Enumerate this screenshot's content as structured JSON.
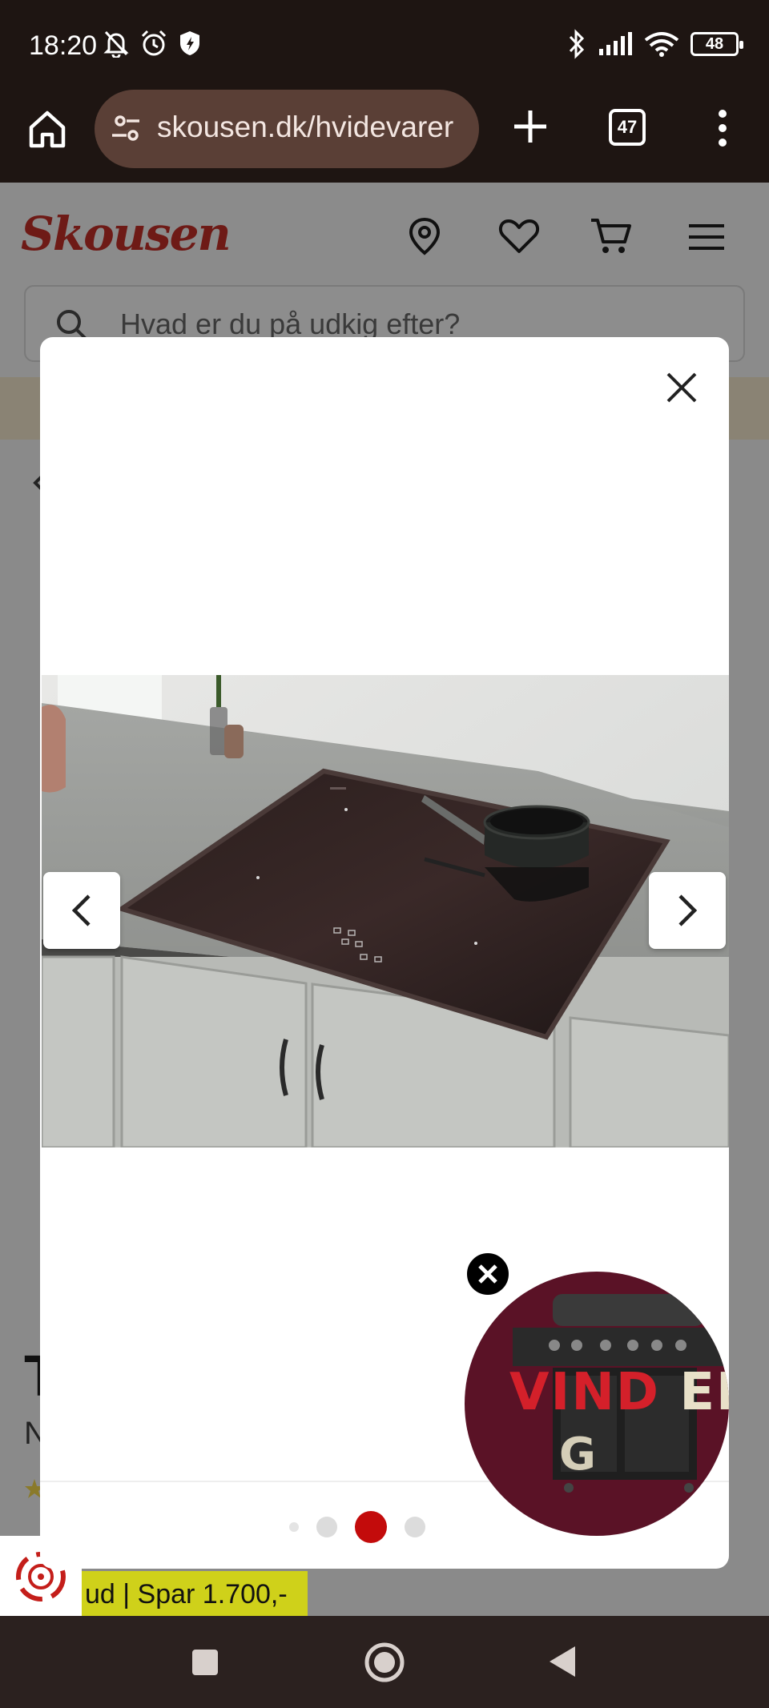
{
  "status_bar": {
    "time": "18:20",
    "battery": "48",
    "icons_left": [
      "bell-off-icon",
      "alarm-icon",
      "shield-icon"
    ],
    "icons_right": [
      "bluetooth-icon",
      "signal-icon",
      "wifi-icon",
      "battery-icon"
    ]
  },
  "browser": {
    "url": "skousen.dk/hvidevarer",
    "tab_count": "47"
  },
  "page": {
    "logo": "Skousen",
    "search_placeholder": "Hvad er du på udkig efter?",
    "product_title_partial": "T",
    "product_sub_partial": "N",
    "sale_tag": "ud | Spar 1.700,-"
  },
  "gallery": {
    "image_alt": "Induction hob installed in grey kitchen countertop with black saucepan",
    "dots_count": 4,
    "active_dot": 2
  },
  "ad": {
    "text_red": "VIND ",
    "text_light": "EN",
    "text_line2": "G"
  },
  "colors": {
    "brand_red": "#c41e1a",
    "status_bg": "#1e1512",
    "url_pill": "#5a3f36",
    "sale_yellow": "#cfd11a",
    "ad_bg": "#5a1226"
  }
}
